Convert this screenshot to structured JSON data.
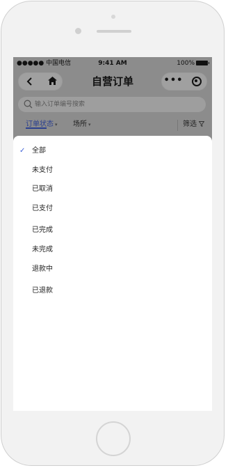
{
  "status_bar": {
    "carrier": "●●●●● 中国电信",
    "time": "9:41 AM",
    "battery": "100%"
  },
  "nav": {
    "back_icon": "chevron-left-icon",
    "home_icon": "home-icon",
    "title": "自营订单",
    "more_label": "•••",
    "close_icon": "target-icon"
  },
  "search": {
    "placeholder": "输入订单编号搜索",
    "value": ""
  },
  "filters": {
    "order_status": "订单状态",
    "venue": "场所",
    "screen": "筛选"
  },
  "options": [
    {
      "label": "全部",
      "selected": true
    },
    {
      "label": "未支付",
      "selected": false
    },
    {
      "label": "已取消",
      "selected": false
    },
    {
      "label": "已支付",
      "selected": false
    },
    {
      "label": "已完成",
      "selected": false
    },
    {
      "label": "未完成",
      "selected": false
    },
    {
      "label": "退款中",
      "selected": false
    },
    {
      "label": "已退款",
      "selected": false
    }
  ],
  "colors": {
    "accent": "#2a3f8f",
    "check": "#3b5fd6",
    "overlay": "#8c8c8c"
  }
}
